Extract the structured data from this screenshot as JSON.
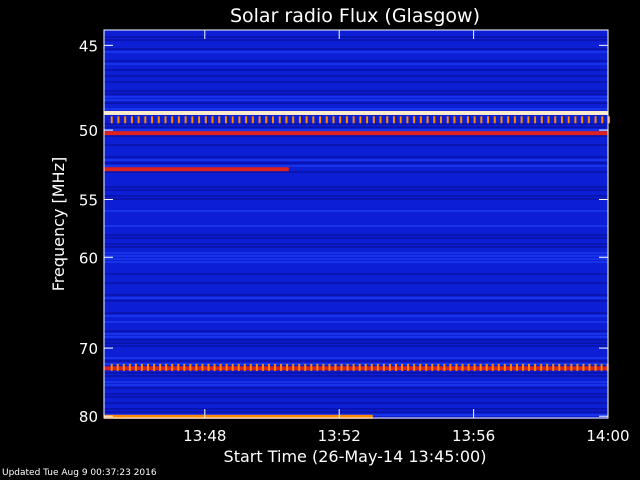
{
  "chart_data": {
    "type": "heatmap",
    "title": "Solar radio Flux (Glasgow)",
    "ylabel": "Frequency [MHz]",
    "xlabel": "Start Time (26-May-14 13:45:00)",
    "x_ticks": [
      "13:48",
      "13:52",
      "13:56",
      "14:00"
    ],
    "x_tick_minutes": [
      3,
      7,
      11,
      15
    ],
    "xlim_minutes": [
      0,
      15
    ],
    "y_ticks": [
      45,
      50,
      55,
      60,
      70,
      80
    ],
    "ylim": [
      44.2,
      80.3
    ],
    "y_scale": "reciprocal",
    "colors": {
      "background": "#0d1fd4",
      "dark_band": "#0a12a8",
      "light_band": "#1a3af0",
      "medium": "#dd2222",
      "hot": "#ff8800",
      "saturated": "#ffeecc"
    },
    "features": [
      {
        "kind": "continuous",
        "freq_mhz": 48.9,
        "level": "saturated"
      },
      {
        "kind": "continuous",
        "freq_mhz": 50.2,
        "level": "medium"
      },
      {
        "kind": "segment",
        "freq_mhz": 52.7,
        "level": "medium",
        "t0_min": 0,
        "t1_min": 5.5
      },
      {
        "kind": "continuous",
        "freq_mhz": 72.7,
        "level": "medium"
      },
      {
        "kind": "periodic_bursts",
        "freq_mhz": 72.5,
        "level": "hot",
        "period_min": 0.18
      },
      {
        "kind": "periodic_bursts",
        "freq_mhz": 49.3,
        "level": "hot",
        "period_min": 0.2
      },
      {
        "kind": "segment",
        "freq_mhz": 80.1,
        "level": "hot",
        "t0_min": 0,
        "t1_min": 8
      }
    ]
  },
  "footer": "Updated Tue Aug  9 00:37:23 2016"
}
